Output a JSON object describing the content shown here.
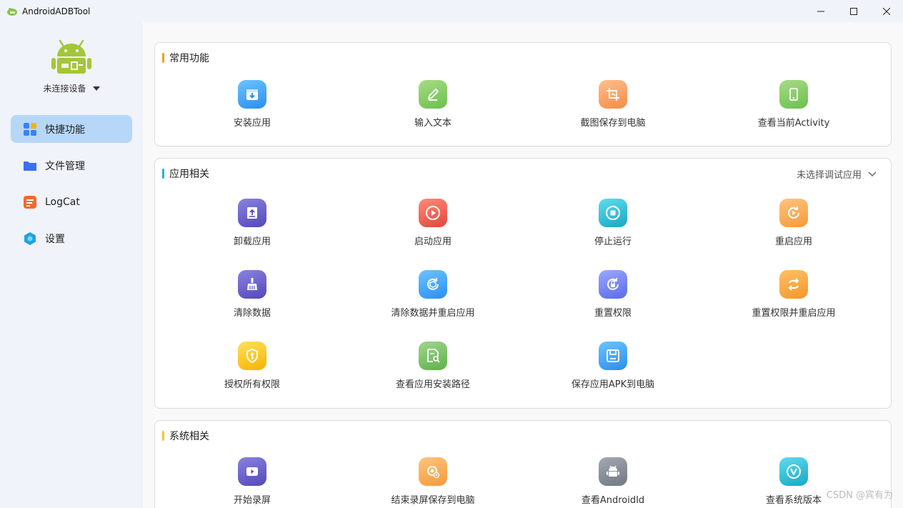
{
  "window": {
    "title": "AndroidADBTool",
    "controls": [
      "minimize",
      "maximize",
      "close"
    ]
  },
  "sidebar": {
    "device_label": "未连接设备",
    "items": [
      {
        "label": "快捷功能",
        "icon": "grid-icon",
        "active": true
      },
      {
        "label": "文件管理",
        "icon": "folder-icon",
        "active": false
      },
      {
        "label": "LogCat",
        "icon": "logcat-icon",
        "active": false
      },
      {
        "label": "设置",
        "icon": "settings-hex-icon",
        "active": false
      }
    ]
  },
  "sections": {
    "common": {
      "title": "常用功能",
      "accent": "#f0a020",
      "items": [
        {
          "label": "安装应用",
          "icon": "install-icon",
          "color": "#3ea6f5"
        },
        {
          "label": "输入文本",
          "icon": "edit-icon",
          "color": "#8fce6a"
        },
        {
          "label": "截图保存到电脑",
          "icon": "crop-icon",
          "color": "#f9a86a"
        },
        {
          "label": "查看当前Activity",
          "icon": "tablet-icon",
          "color": "#8fce6a"
        }
      ]
    },
    "app": {
      "title": "应用相关",
      "accent": "#2ab3c8",
      "app_select_label": "未选择调试应用",
      "items": [
        {
          "label": "卸载应用",
          "icon": "uninstall-icon",
          "color": "#6a63c9"
        },
        {
          "label": "启动应用",
          "icon": "play-icon",
          "color": "#f0685a"
        },
        {
          "label": "停止运行",
          "icon": "stop-icon",
          "color": "#2ec5dc"
        },
        {
          "label": "重启应用",
          "icon": "restart-icon",
          "color": "#f9ad5c"
        },
        {
          "label": "清除数据",
          "icon": "broom-icon",
          "color": "#6a63c9"
        },
        {
          "label": "清除数据并重启应用",
          "icon": "box-refresh-icon",
          "color": "#3ea6f5"
        },
        {
          "label": "重置权限",
          "icon": "lock-refresh-icon",
          "color": "#6f7ff0"
        },
        {
          "label": "重置权限并重启应用",
          "icon": "loop-icon",
          "color": "#f9a640"
        },
        {
          "label": "授权所有权限",
          "icon": "shield-key-icon",
          "color": "#f7c52c"
        },
        {
          "label": "查看应用安装路径",
          "icon": "file-search-icon",
          "color": "#7cc66a"
        },
        {
          "label": "保存应用APK到电脑",
          "icon": "save-icon",
          "color": "#3ea6f5"
        }
      ]
    },
    "system": {
      "title": "系统相关",
      "accent": "#f7c52c",
      "items": [
        {
          "label": "开始录屏",
          "icon": "video-icon",
          "color": "#6a63c9"
        },
        {
          "label": "结束录屏保存到电脑",
          "icon": "record-save-icon",
          "color": "#f9ad5c"
        },
        {
          "label": "查看AndroidId",
          "icon": "android-icon",
          "color": "#8a8f99"
        },
        {
          "label": "查看系统版本",
          "icon": "version-icon",
          "color": "#2ec5dc"
        }
      ]
    }
  },
  "watermark": "CSDN @宾有为"
}
